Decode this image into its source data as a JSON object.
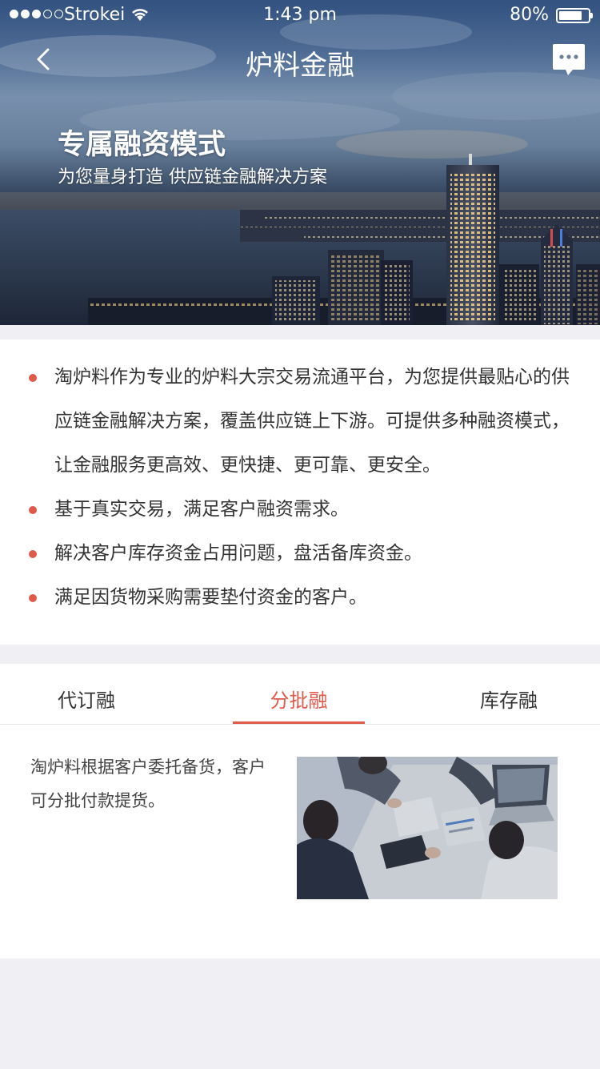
{
  "status_bar": {
    "carrier": "Strokei",
    "time": "1:43 pm",
    "battery": "80%",
    "battery_level": 0.8
  },
  "nav": {
    "title": "炉料金融",
    "back_icon": "chevron-left-icon",
    "message_icon": "chat-bubble-icon"
  },
  "hero": {
    "heading": "专属融资模式",
    "subheading": "为您量身打造 供应链金融解决方案"
  },
  "intro": {
    "items": [
      "淘炉料作为专业的炉料大宗交易流通平台，为您提供最贴心的供应链金融解决方案，覆盖供应链上下游。可提供多种融资模式，让金融服务更高效、更快捷、更可靠、更安全。",
      "基于真实交易，满足客户融资需求。",
      "解决客户库存资金占用问题，盘活备库资金。",
      "满足因货物采购需要垫付资金的客户。"
    ]
  },
  "tabs": {
    "items": [
      "代订融",
      "分批融",
      "库存融"
    ],
    "active": "分批融",
    "content": "淘炉料根据客户委托备货，客户可分批付款提货。"
  },
  "colors": {
    "accent": "#e05a4b",
    "text": "#333333",
    "background": "#efeff4"
  }
}
